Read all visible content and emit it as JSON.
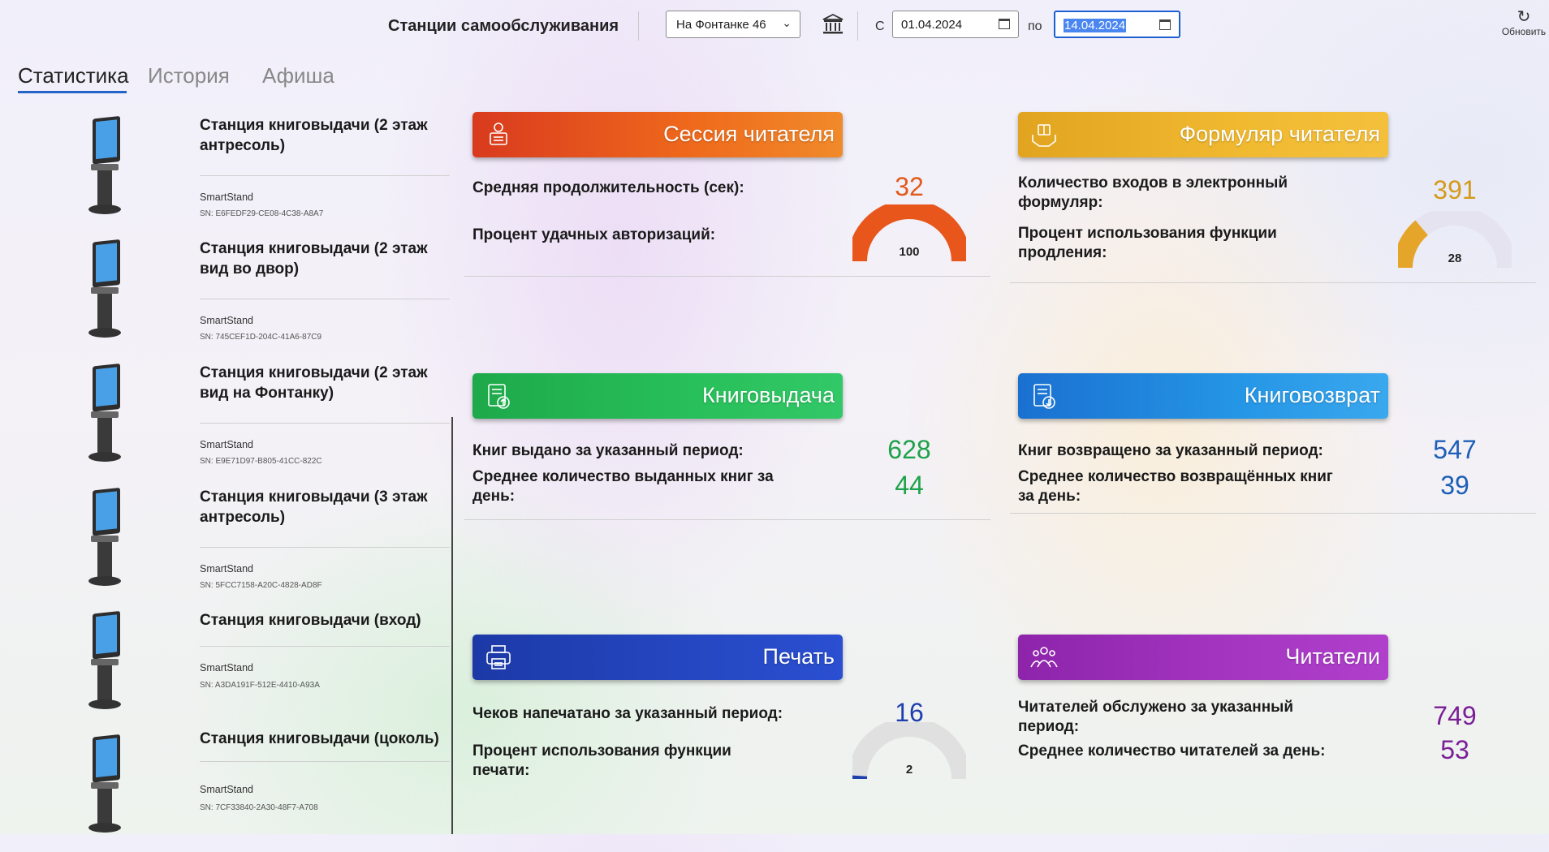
{
  "header": {
    "title": "Станции самообслуживания",
    "library_select": "На Фонтанке 46",
    "from_label": "С",
    "date_from": "01.04.2024",
    "to_label": "по",
    "date_to": "14.04.2024",
    "refresh_label": "Обновить"
  },
  "tabs": [
    {
      "label": "Статистика",
      "active": true
    },
    {
      "label": "История",
      "active": false
    },
    {
      "label": "Афиша",
      "active": false
    }
  ],
  "stations": [
    {
      "name": "Станция книговыдачи (2 этаж антресоль)",
      "model": "SmartStand",
      "sn": "SN: E6FEDF29-CE08-4C38-A8A7"
    },
    {
      "name": "Станция книговыдачи (2 этаж вид во двор)",
      "model": "SmartStand",
      "sn": "SN: 745CEF1D-204C-41A6-87C9"
    },
    {
      "name": "Станция книговыдачи (2 этаж вид на Фонтанку)",
      "model": "SmartStand",
      "sn": "SN: E9E71D97-B805-41CC-822C"
    },
    {
      "name": "Станция книговыдачи (3 этаж антресоль)",
      "model": "SmartStand",
      "sn": "SN: 5FCC7158-A20C-4828-AD8F"
    },
    {
      "name": "Станция книговыдачи (вход)",
      "model": "SmartStand",
      "sn": "SN: A3DA191F-512E-4410-A93A"
    },
    {
      "name": "Станция книговыдачи (цоколь)",
      "model": "SmartStand",
      "sn": "SN: 7CF33840-2A30-48F7-A708"
    }
  ],
  "cards": {
    "session": {
      "title": "Сессия читателя",
      "color": "#e8561c",
      "avg_duration_label": "Средняя продолжительность (сек):",
      "avg_duration_value": "32",
      "success_auth_label": "Процент удачных авторизаций:",
      "success_auth_value": "100",
      "gauge_fraction": 1.0
    },
    "formular": {
      "title": "Формуляр читателя",
      "color": "#e4a52a",
      "logins_label": "Количество входов в электронный формуляр:",
      "logins_value": "391",
      "renew_label": "Процент использования функции продления:",
      "renew_value": "28",
      "gauge_fraction": 0.28
    },
    "checkout": {
      "title": "Книговыдача",
      "color": "#1aa64a",
      "issued_label": "Книг выдано за указанный период:",
      "issued_value": "628",
      "avg_label": "Среднее количество выданных книг за день:",
      "avg_value": "44"
    },
    "return": {
      "title": "Книговозврат",
      "color": "#1d7fd8",
      "returned_label": "Книг возвращено за указанный период:",
      "returned_value": "547",
      "avg_label": "Среднее количество возвращённых книг за день:",
      "avg_value": "39"
    },
    "print": {
      "title": "Печать",
      "color": "#1f3fae",
      "receipts_label": "Чеков напечатано за указанный период:",
      "receipts_value": "16",
      "usage_label": "Процент использования функции печати:",
      "usage_value": "2",
      "gauge_fraction": 0.02
    },
    "readers": {
      "title": "Читатели",
      "color": "#9c2bb5",
      "served_label": "Читателей обслужено за указанный период:",
      "served_value": "749",
      "avg_label": "Среднее количество читателей за день:",
      "avg_value": "53"
    }
  }
}
